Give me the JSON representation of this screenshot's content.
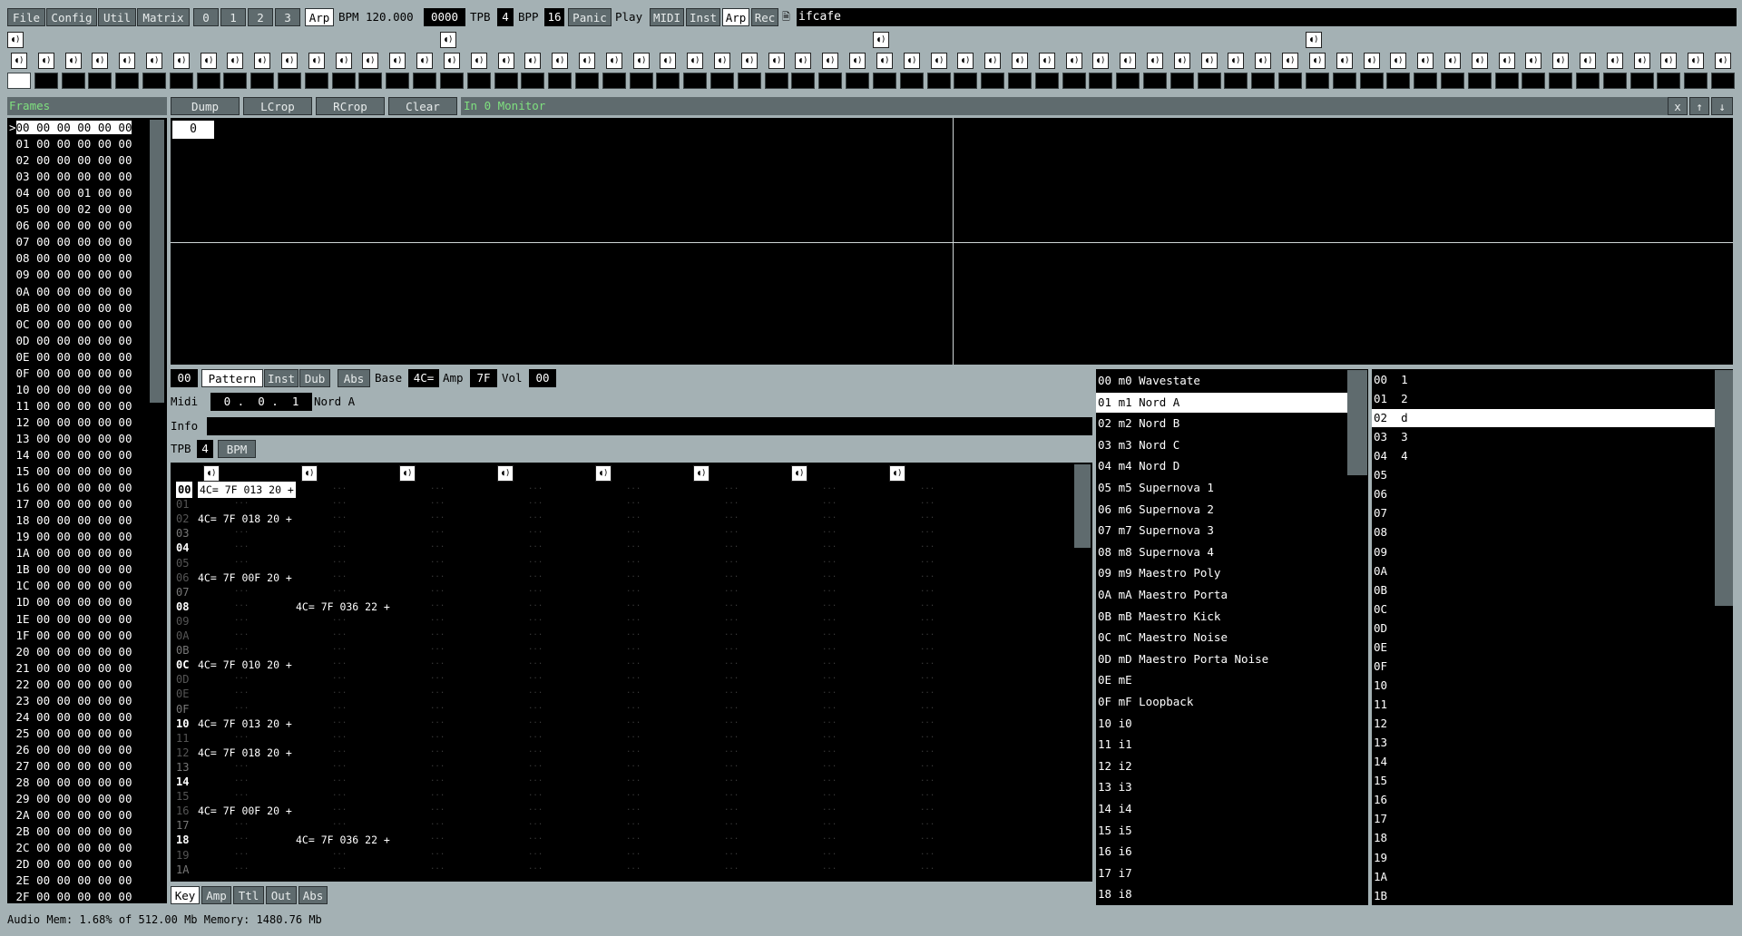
{
  "toolbar": {
    "file": "File",
    "config": "Config",
    "util": "Util",
    "matrix": "Matrix",
    "layers": [
      "0",
      "1",
      "2",
      "3"
    ],
    "arp": "Arp",
    "bpm_label": "BPM",
    "bpm_value": "120.000",
    "counter": "0000",
    "tpb_label": "TPB",
    "tpb_value": "4",
    "bpp_label": "BPP",
    "bpp_value": "16",
    "panic": "Panic",
    "play": "Play",
    "midi": "MIDI",
    "inst": "Inst",
    "arp2": "Arp",
    "rec": "Rec",
    "filename": "ifcafe"
  },
  "frames": {
    "title": "Frames",
    "rows": [
      "00 00 00 00 00 00",
      "01 00 00 00 00 00",
      "02 00 00 00 00 00",
      "03 00 00 00 00 00",
      "04 00 00 01 00 00",
      "05 00 00 02 00 00",
      "06 00 00 00 00 00",
      "07 00 00 00 00 00",
      "08 00 00 00 00 00",
      "09 00 00 00 00 00",
      "0A 00 00 00 00 00",
      "0B 00 00 00 00 00",
      "0C 00 00 00 00 00",
      "0D 00 00 00 00 00",
      "0E 00 00 00 00 00",
      "0F 00 00 00 00 00",
      "10 00 00 00 00 00",
      "11 00 00 00 00 00",
      "12 00 00 00 00 00",
      "13 00 00 00 00 00",
      "14 00 00 00 00 00",
      "15 00 00 00 00 00",
      "16 00 00 00 00 00",
      "17 00 00 00 00 00",
      "18 00 00 00 00 00",
      "19 00 00 00 00 00",
      "1A 00 00 00 00 00",
      "1B 00 00 00 00 00",
      "1C 00 00 00 00 00",
      "1D 00 00 00 00 00",
      "1E 00 00 00 00 00",
      "1F 00 00 00 00 00",
      "20 00 00 00 00 00",
      "21 00 00 00 00 00",
      "22 00 00 00 00 00",
      "23 00 00 00 00 00",
      "24 00 00 00 00 00",
      "25 00 00 00 00 00",
      "26 00 00 00 00 00",
      "27 00 00 00 00 00",
      "28 00 00 00 00 00",
      "29 00 00 00 00 00",
      "2A 00 00 00 00 00",
      "2B 00 00 00 00 00",
      "2C 00 00 00 00 00",
      "2D 00 00 00 00 00",
      "2E 00 00 00 00 00",
      "2F 00 00 00 00 00"
    ]
  },
  "monitor": {
    "dump": "Dump",
    "lcrop": "LCrop",
    "rcrop": "RCrop",
    "clear": "Clear",
    "label": "In 0 Monitor",
    "close": "x",
    "up": "↑",
    "down": "↓",
    "channel": "0"
  },
  "pattern": {
    "index": "00",
    "tab_pattern": "Pattern",
    "tab_inst": "Inst",
    "tab_dub": "Dub",
    "abs": "Abs",
    "base_label": "Base",
    "base_value": "4C=",
    "amp_label": "Amp",
    "amp_value": "7F",
    "vol_label": "Vol",
    "vol_value": "00",
    "midi_label": "Midi",
    "midi_value": "0 .  0 .  1",
    "midi_name": "Nord A",
    "info_label": "Info",
    "tpb_label": "TPB",
    "tpb_value": "4",
    "bpm_btn": "BPM"
  },
  "grid": {
    "rows": [
      "00",
      "01",
      "02",
      "03",
      "04",
      "05",
      "06",
      "07",
      "08",
      "09",
      "0A",
      "0B",
      "0C",
      "0D",
      "0E",
      "0F",
      "10",
      "11",
      "12",
      "13",
      "14",
      "15",
      "16",
      "17",
      "18",
      "19",
      "1A"
    ],
    "notes": [
      {
        "row": "00",
        "track": 0,
        "text": "4C= 7F 013 20 +"
      },
      {
        "row": "02",
        "track": 0,
        "text": "4C= 7F 018 20 +"
      },
      {
        "row": "06",
        "track": 0,
        "text": "4C= 7F 00F 20 +"
      },
      {
        "row": "08",
        "track": 1,
        "text": "4C= 7F 036 22 +"
      },
      {
        "row": "0C",
        "track": 0,
        "text": "4C= 7F 010 20 +"
      },
      {
        "row": "10",
        "track": 0,
        "text": "4C= 7F 013 20 +"
      },
      {
        "row": "12",
        "track": 0,
        "text": "4C= 7F 018 20 +"
      },
      {
        "row": "16",
        "track": 0,
        "text": "4C= 7F 00F 20 +"
      },
      {
        "row": "18",
        "track": 1,
        "text": "4C= 7F 036 22 +"
      }
    ],
    "empty": "..."
  },
  "bottom_tabs": [
    "Key",
    "Amp",
    "Ttl",
    "Out",
    "Abs"
  ],
  "instruments": [
    "00 m0 Wavestate",
    "01 m1 Nord A",
    "02 m2 Nord B",
    "03 m3 Nord C",
    "04 m4 Nord D",
    "05 m5 Supernova 1",
    "06 m6 Supernova 2",
    "07 m7 Supernova 3",
    "08 m8 Supernova 4",
    "09 m9 Maestro Poly",
    "0A mA Maestro Porta",
    "0B mB Maestro Kick",
    "0C mC Maestro Noise",
    "0D mD Maestro Porta Noise",
    "0E mE",
    "0F mF Loopback",
    "10 i0",
    "11 i1",
    "12 i2",
    "13 i3",
    "14 i4",
    "15 i5",
    "16 i6",
    "17 i7",
    "18 i8"
  ],
  "patterns": [
    "00  1",
    "01  2",
    "02  d",
    "03  3",
    "04  4",
    "05",
    "06",
    "07",
    "08",
    "09",
    "0A",
    "0B",
    "0C",
    "0D",
    "0E",
    "0F",
    "10",
    "11",
    "12",
    "13",
    "14",
    "15",
    "16",
    "17",
    "18",
    "19",
    "1A",
    "1B"
  ],
  "status": {
    "text": "Audio Mem: 1.68% of 512.00 Mb Memory: 1480.76 Mb"
  }
}
